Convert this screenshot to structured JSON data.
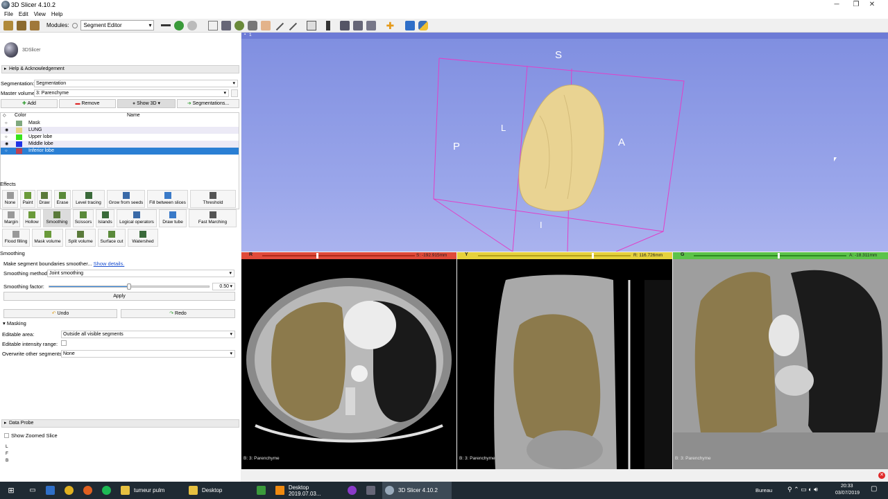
{
  "window": {
    "title": "3D Slicer 4.10.2"
  },
  "menu": [
    "File",
    "Edit",
    "View",
    "Help"
  ],
  "toolbar": {
    "modules_label": "Modules:",
    "module_selected": "Segment Editor"
  },
  "logo_text": "3DSlicer",
  "help_section": "Help & Acknowledgement",
  "segmentation": {
    "label": "Segmentation:",
    "value": "Segmentation"
  },
  "master_volume": {
    "label": "Master volume:",
    "value": "3: Parenchyme"
  },
  "seg_buttons": {
    "add": "Add",
    "remove": "Remove",
    "show3d": "Show 3D",
    "segmentations": "Segmentations..."
  },
  "table": {
    "col_color": "Color",
    "col_name": "Name",
    "rows": [
      {
        "name": "Mask",
        "color": "#7fa87f",
        "visible": false,
        "selected": false
      },
      {
        "name": "LUNG",
        "color": "#e6d289",
        "visible": true,
        "selected": false
      },
      {
        "name": "Upper lobe",
        "color": "#39e31c",
        "visible": false,
        "selected": false
      },
      {
        "name": "Middle lobe",
        "color": "#2032e6",
        "visible": true,
        "selected": false
      },
      {
        "name": "Inferior lobe",
        "color": "#c04050",
        "visible": false,
        "selected": true
      }
    ]
  },
  "effects": {
    "label": "Effects",
    "row1": [
      "None",
      "Paint",
      "Draw",
      "Erase",
      "Level tracing",
      "Grow from seeds",
      "Fill between slices",
      "Threshold"
    ],
    "row2": [
      "Margin",
      "Hollow",
      "Smoothing",
      "Scissors",
      "Islands",
      "Logical operators",
      "Draw tube",
      "Fast Marching"
    ],
    "row3": [
      "Flood filling",
      "Mask volume",
      "Split volume",
      "Surface cut",
      "Watershed"
    ]
  },
  "smoothing": {
    "title": "Smoothing",
    "description": "Make segment boundaries smoother...",
    "details_link": "Show details.",
    "method_label": "Smoothing method:",
    "method_value": "Joint smoothing",
    "factor_label": "Smoothing factor:",
    "factor_value": "0.50",
    "factor_level": 0.5,
    "apply": "Apply",
    "undo": "Undo",
    "redo": "Redo"
  },
  "masking": {
    "title": "Masking",
    "editable_area_label": "Editable area:",
    "editable_area_value": "Outside all visible segments",
    "intensity_label": "Editable intensity range:",
    "overwrite_label": "Overwrite other segments:",
    "overwrite_value": "None"
  },
  "data_probe": {
    "title": "Data Probe",
    "show_zoomed": "Show Zoomed Slice",
    "lines": [
      "L",
      "F",
      "B"
    ]
  },
  "view3d": {
    "tab": "1",
    "labels": {
      "S": "S",
      "L": "L",
      "P": "P",
      "A": "A",
      "I": "I"
    }
  },
  "slices": [
    {
      "letter": "R",
      "offset": "S: -192.915mm",
      "caption": "B: 3: Parenchyme",
      "color": "#e04a3a"
    },
    {
      "letter": "Y",
      "offset": "R: 116.726mm",
      "caption": "B: 3: Parenchyme",
      "color": "#e6d23c"
    },
    {
      "letter": "G",
      "offset": "A: -18.311mm",
      "caption": "B: 3: Parenchyme",
      "color": "#5cc34a"
    }
  ],
  "taskbar": {
    "items": [
      "tumeur pulm",
      "Desktop",
      "Desktop 2019.07.03...",
      "3D Slicer 4.10.2"
    ],
    "tray_label": "Bureau",
    "time": "20:33",
    "date": "03/07/2019"
  }
}
